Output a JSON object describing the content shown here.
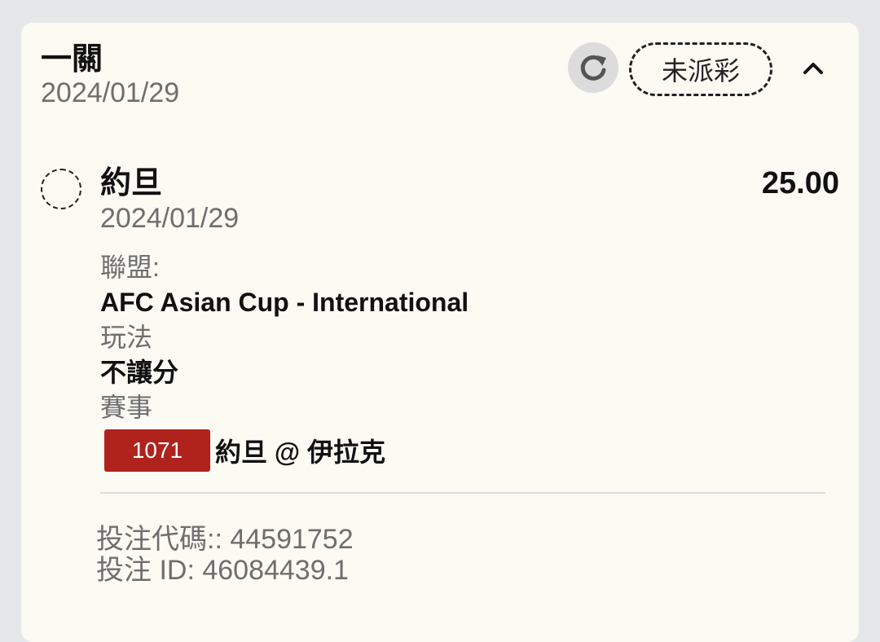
{
  "bet": {
    "type": "一關",
    "date": "2024/01/29",
    "status": "未派彩"
  },
  "icons": {
    "refresh": "refresh-icon",
    "collapse": "chevron-up-icon",
    "leg_status": "pending-circle-icon"
  },
  "leg": {
    "team": "約旦",
    "odds": "25.00",
    "date": "2024/01/29",
    "league_label": "聯盟:",
    "league_value": "AFC Asian Cup - International",
    "market_label": "玩法",
    "market_value": "不讓分",
    "event_label": "賽事",
    "event_id": "1071",
    "event_name": "約旦 @ 伊拉克"
  },
  "footer": {
    "bet_code": "投注代碼:: 44591752",
    "bet_id": "投注 ID: 46084439.1"
  },
  "colors": {
    "event_badge": "#b0221c",
    "card_bg": "#fbfaf3",
    "page_bg": "#e6e7e9"
  }
}
